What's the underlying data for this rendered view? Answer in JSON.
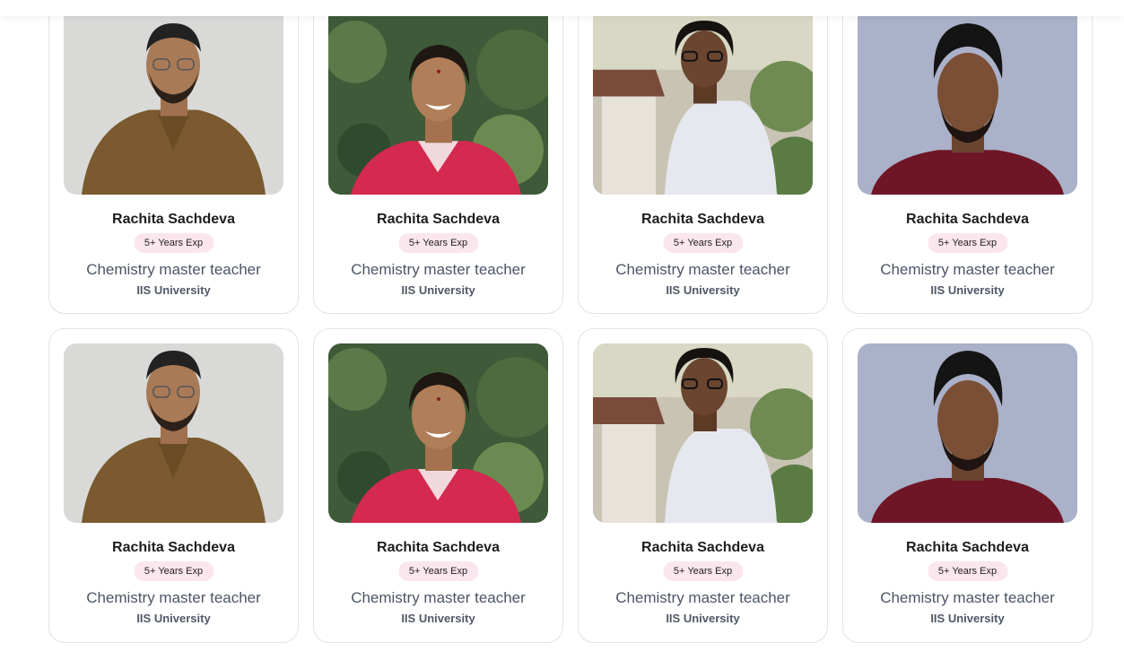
{
  "teachers": [
    {
      "name": "Rachita Sachdeva",
      "experience": "5+ Years Exp",
      "role": "Chemistry master teacher",
      "university": "IIS University"
    },
    {
      "name": "Rachita Sachdeva",
      "experience": "5+ Years Exp",
      "role": "Chemistry master teacher",
      "university": "IIS University"
    },
    {
      "name": "Rachita Sachdeva",
      "experience": "5+ Years Exp",
      "role": "Chemistry master teacher",
      "university": "IIS University"
    },
    {
      "name": "Rachita Sachdeva",
      "experience": "5+ Years Exp",
      "role": "Chemistry master teacher",
      "university": "IIS University"
    },
    {
      "name": "Rachita Sachdeva",
      "experience": "5+ Years Exp",
      "role": "Chemistry master teacher",
      "university": "IIS University"
    },
    {
      "name": "Rachita Sachdeva",
      "experience": "5+ Years Exp",
      "role": "Chemistry master teacher",
      "university": "IIS University"
    },
    {
      "name": "Rachita Sachdeva",
      "experience": "5+ Years Exp",
      "role": "Chemistry master teacher",
      "university": "IIS University"
    },
    {
      "name": "Rachita Sachdeva",
      "experience": "5+ Years Exp",
      "role": "Chemistry master teacher",
      "university": "IIS University"
    }
  ],
  "colors": {
    "badge_bg": "#fbe6ee",
    "card_border": "#e2e2e2",
    "name_text": "#1d1d1f",
    "role_text": "#4c5566"
  }
}
